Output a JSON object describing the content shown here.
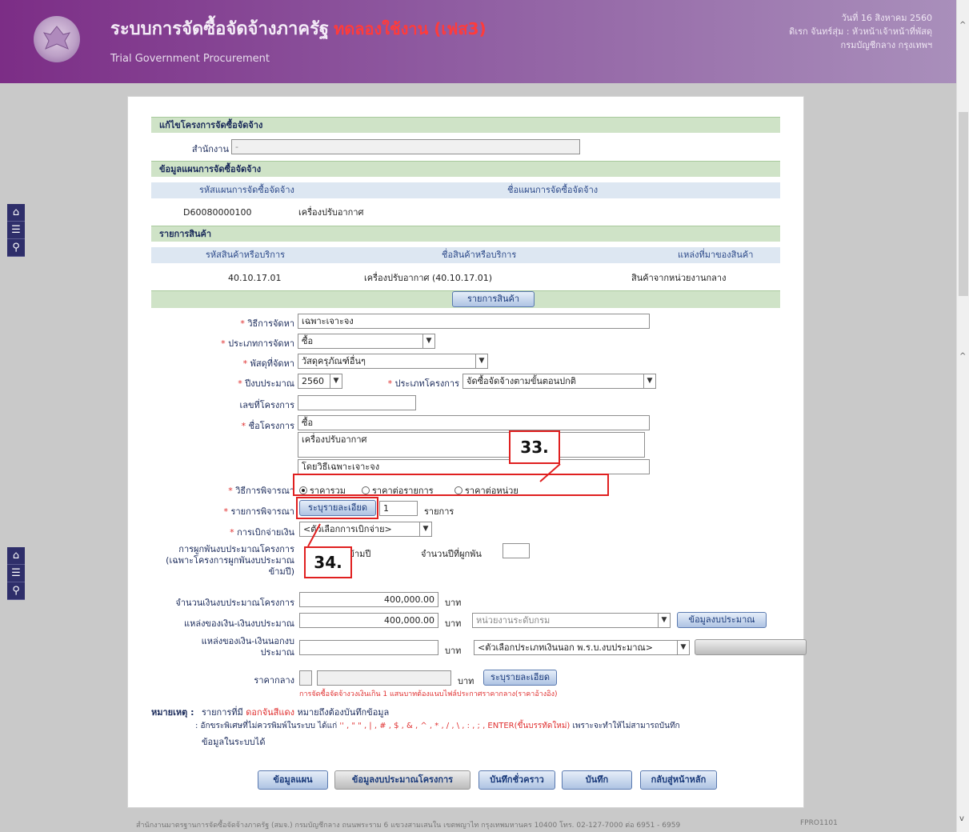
{
  "header": {
    "title": "ระบบการจัดซื้อจัดจ้างภาครัฐ",
    "title_suffix": "ทดลองใช้งาน (เฟส3)",
    "subtitle": "Trial Government Procurement",
    "date": "วันที่ 16 สิงหาคม 2560",
    "user": "ดิเรก จันทร์สุ่ม : หัวหน้าเจ้าหน้าที่พัสดุ",
    "department": "กรมบัญชีกลาง กรุงเทพฯ"
  },
  "sidebar": {
    "icons": [
      "home-icon",
      "menu-icon",
      "search-icon"
    ]
  },
  "page": {
    "section_title": "แก้ไขโครงการจัดซื้อจัดจ้าง",
    "office_label": "สำนักงาน",
    "office_value": "-",
    "plan_section": "ข้อมูลแผนการจัดซื้อจัดจ้าง",
    "plan_cols": [
      "รหัสแผนการจัดซื้อจัดจ้าง",
      "ชื่อแผนการจัดซื้อจัดจ้าง"
    ],
    "plan_row": [
      "D60080000100",
      "เครื่องปรับอากาศ"
    ],
    "items_section": "รายการสินค้า",
    "items_cols": [
      "รหัสสินค้าหรือบริการ",
      "ชื่อสินค้าหรือบริการ",
      "แหล่งที่มาของสินค้า"
    ],
    "items_row": [
      "40.10.17.01",
      "เครื่องปรับอากาศ (40.10.17.01)",
      "สินค้าจากหน่วยงานกลาง"
    ],
    "items_button": "รายการสินค้า"
  },
  "form": {
    "method_label": "วิธีการจัดหา",
    "method_value": "เฉพาะเจาะจง",
    "type_label": "ประเภทการจัดหา",
    "type_value": "ซื้อ",
    "category_label": "พัสดุที่จัดหา",
    "category_value": "วัสดุครุภัณฑ์อื่นๆ",
    "budget_year_label": "ปีงบประมาณ",
    "budget_year_value": "2560",
    "project_type_label": "ประเภทโครงการ",
    "project_type_value": "จัดซื้อจัดจ้างตามขั้นตอนปกติ",
    "project_no_label": "เลขที่โครงการ",
    "project_no_value": "",
    "project_name_label": "ชื่อโครงการ",
    "project_name_lines": [
      "ซื้อ",
      "เครื่องปรับอากาศ",
      "โดยวิธีเฉพาะเจาะจง"
    ],
    "consider_label": "วิธีการพิจารณา",
    "consider_options": [
      "ราคารวม",
      "ราคาต่อรายการ",
      "ราคาต่อหน่วย"
    ],
    "consider_items_label": "รายการพิจารณา",
    "consider_items_button": "ระบุรายละเอียด",
    "consider_items_count": "1",
    "consider_items_unit": "รายการ",
    "payment_label": "การเบิกจ่ายเงิน",
    "payment_value": "<ตัวเลือกการเบิกจ่าย>",
    "commit_label_1": "การผูกพันงบประมาณโครงการ",
    "commit_label_2": "(เฉพาะโครงการผูกพันงบประมาณ",
    "commit_label_3": "ข้ามปี)",
    "commit_option": "ประมาณข้ามปี",
    "commit_years_label": "จำนวนปีที่ผูกพัน",
    "budget_amount_label": "จำนวนเงินงบประมาณโครงการ",
    "budget_amount_value": "400,000.00",
    "baht": "บาท",
    "source_label": "แหล่งของเงิน-เงินงบประมาณ",
    "source_value": "400,000.00",
    "source_select": "หน่วยงานระดับกรม",
    "source_button": "ข้อมูลงบประมาณ",
    "offbudget_label_1": "แหล่งของเงิน-เงินนอกงบ",
    "offbudget_label_2": "ประมาณ",
    "offbudget_select": "<ตัวเลือกประเภทเงินนอก พ.ร.บ.งบประมาณ>",
    "median_label": "ราคากลาง",
    "median_button": "ระบุรายละเอียด",
    "median_note": "การจัดซื้อจัดจ้างวงเงินเกิน 1 แสนบาทต้องแนบไฟล์ประกาศราคากลาง(ราคาอ้างอิง)"
  },
  "notes": {
    "label": "หมายเหตุ :",
    "line1_a": "รายการที่มี",
    "line1_red": "ดอกจันสีแดง",
    "line1_b": "หมายถึงต้องบันทึกข้อมูล",
    "line2_a": ": อักขระพิเศษที่ไม่ควรพิมพ์ในระบบ ได้แก่",
    "line2_red": "'' , \" \" , | , # , $ , & , ^ , * , / , \\ , : , ; , ENTER(ขึ้นบรรทัดใหม่)",
    "line2_b": "เพราะจะทำให้ไม่สามารถบันทึก",
    "line3": "ข้อมูลในระบบได้"
  },
  "actions": [
    "ข้อมูลแผน",
    "ข้อมูลงบประมาณโครงการ",
    "บันทึกชั่วคราว",
    "บันทึก",
    "กลับสู่หน้าหลัก"
  ],
  "annotations": {
    "box33": "33.",
    "box34": "34."
  },
  "footer": {
    "text": "สำนักงานมาตรฐานการจัดซื้อจัดจ้างภาครัฐ (สมจ.) กรมบัญชีกลาง ถนนพระราม 6 แขวงสามเสนใน เขตพญาไท กรุงเทพมหานคร 10400 โทร. 02-127-7000 ต่อ 6951 - 6959",
    "code": "FPRO1101"
  },
  "colors": {
    "header": "#7c2d86",
    "section": "#cfe3c7",
    "column_header": "#dde7f2",
    "required": "#e03030",
    "annotation": "#e02020"
  }
}
